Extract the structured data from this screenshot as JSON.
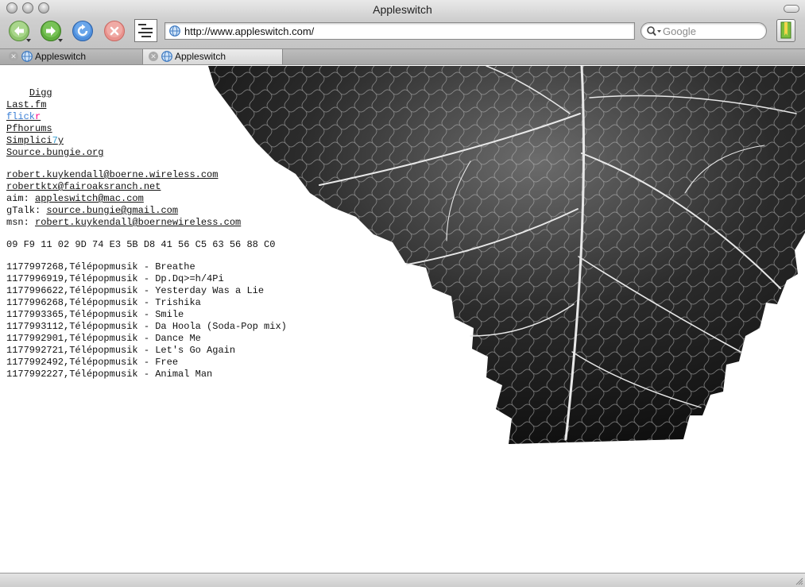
{
  "window": {
    "title": "Appleswitch"
  },
  "toolbar": {
    "url": "http://www.appleswitch.com/",
    "search_placeholder": "Google"
  },
  "tabs": [
    {
      "label": "Appleswitch",
      "active": false
    },
    {
      "label": "Appleswitch",
      "active": true
    }
  ],
  "links": {
    "digg": "Digg",
    "lastfm": "Last.fm",
    "flickr_a": "flick",
    "flickr_b": "r",
    "pfhorums": "Pfhorums",
    "simplicity_a": "Simplici",
    "simplicity_b": "7",
    "simplicity_c": "y",
    "bungie": "Source.bungie.org"
  },
  "contact": {
    "email1": "robert.kuykendall@boerne.wireless.com",
    "email2": "robertktx@fairoaksranch.net",
    "aim_label": "aim: ",
    "aim": "appleswitch@mac.com",
    "gtalk_label": "gTalk: ",
    "gtalk": "source.bungie@gmail.com",
    "msn_label": "msn: ",
    "msn": "robert.kuykendall@boernewireless.com"
  },
  "hex_line": "09 F9 11 02 9D 74 E3 5B D8 41 56 C5 63 56 88 C0",
  "tracks": [
    "1177997268,Télépopmusik - Breathe",
    "1177996919,Télépopmusik - Dp.Dq>=h/4Pi",
    "1177996622,Télépopmusik - Yesterday Was a Lie",
    "1177996268,Télépopmusik - Trishika",
    "1177993365,Télépopmusik - Smile",
    "1177993112,Télépopmusik - Da Hoola (Soda-Pop mix)",
    "1177992901,Télépopmusik - Dance Me",
    "1177992721,Télépopmusik - Let's Go Again",
    "1177992492,Télépopmusik - Free",
    "1177992227,Télépopmusik - Animal Man"
  ],
  "colors": {
    "flickr_blue": "#3b7fd6",
    "flickr_pink": "#ff0084",
    "simplicity_accent": "#3a9fd1",
    "back_green": "#5aa73a",
    "reload_blue": "#3f7fcf",
    "stop_red": "#d94a44"
  },
  "icons": {
    "back": "arrow-left-icon",
    "forward": "arrow-right-icon",
    "reload": "reload-icon",
    "stop": "stop-icon",
    "source": "view-source-icon",
    "favicon": "globe-icon",
    "search": "magnifier-icon",
    "bookmarks": "bookmark-icon",
    "decoration": "leaf-photo"
  }
}
